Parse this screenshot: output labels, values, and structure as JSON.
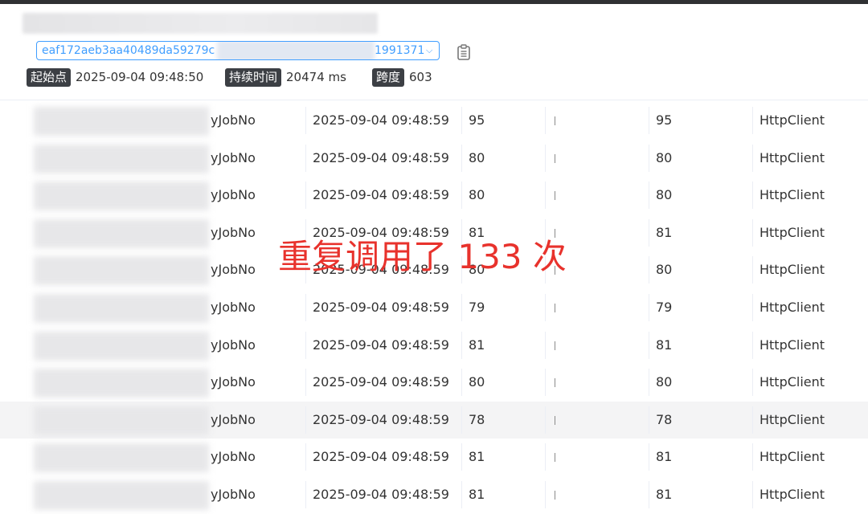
{
  "header": {
    "trace_id_start": "eaf172aeb3aa40489da59279c",
    "trace_id_end": "1991371",
    "start_label": "起始点",
    "start_value": "2025-09-04 09:48:50",
    "duration_label": "持续时间",
    "duration_value": "20474 ms",
    "span_label": "跨度",
    "span_value": "603"
  },
  "rows": [
    {
      "name": "yJobNo",
      "time": "2025-09-04 09:48:59",
      "dur": "95",
      "dur2": "95",
      "type": "HttpClient"
    },
    {
      "name": "yJobNo",
      "time": "2025-09-04 09:48:59",
      "dur": "80",
      "dur2": "80",
      "type": "HttpClient"
    },
    {
      "name": "yJobNo",
      "time": "2025-09-04 09:48:59",
      "dur": "80",
      "dur2": "80",
      "type": "HttpClient"
    },
    {
      "name": "yJobNo",
      "time": "2025-09-04 09:48:59",
      "dur": "81",
      "dur2": "81",
      "type": "HttpClient"
    },
    {
      "name": "yJobNo",
      "time": "2025-09-04 09:48:59",
      "dur": "80",
      "dur2": "80",
      "type": "HttpClient"
    },
    {
      "name": "yJobNo",
      "time": "2025-09-04 09:48:59",
      "dur": "79",
      "dur2": "79",
      "type": "HttpClient"
    },
    {
      "name": "yJobNo",
      "time": "2025-09-04 09:48:59",
      "dur": "81",
      "dur2": "81",
      "type": "HttpClient"
    },
    {
      "name": "yJobNo",
      "time": "2025-09-04 09:48:59",
      "dur": "80",
      "dur2": "80",
      "type": "HttpClient"
    },
    {
      "name": "yJobNo",
      "time": "2025-09-04 09:48:59",
      "dur": "78",
      "dur2": "78",
      "type": "HttpClient"
    },
    {
      "name": "yJobNo",
      "time": "2025-09-04 09:48:59",
      "dur": "81",
      "dur2": "81",
      "type": "HttpClient"
    },
    {
      "name": "yJobNo",
      "time": "2025-09-04 09:48:59",
      "dur": "81",
      "dur2": "81",
      "type": "HttpClient"
    }
  ],
  "overlay_text": "重复调用了 133 次",
  "colors": {
    "accent": "#409eff",
    "tag_bg": "#3c3f44",
    "overlay": "#e8322c",
    "highlight_row": "#f4f4f5"
  },
  "icons": {
    "copy": "clipboard-icon",
    "dropdown": "chevron-down-icon"
  }
}
